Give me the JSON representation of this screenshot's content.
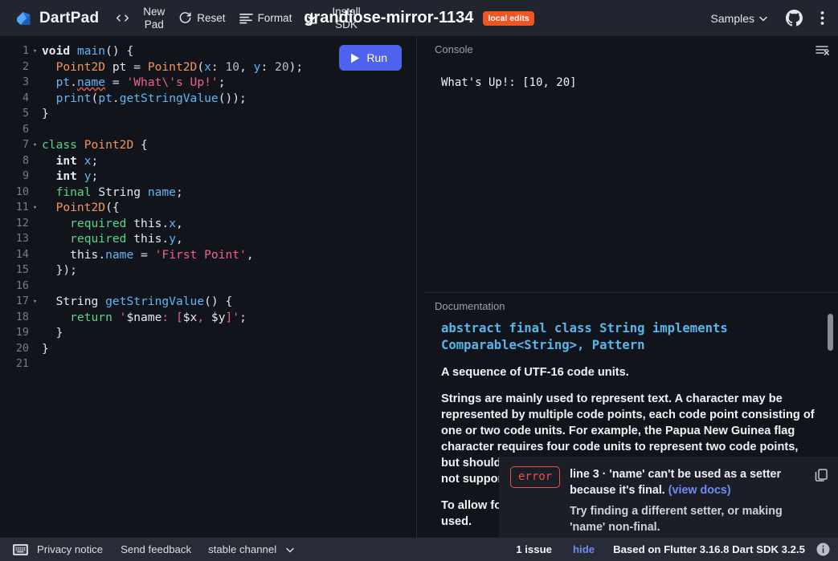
{
  "header": {
    "brand": "DartPad",
    "logo_icon": "dart-logo-icon",
    "actions": [
      {
        "icon": "code-brackets-icon",
        "label": "",
        "label2": ""
      },
      {
        "icon": "",
        "label": "New",
        "label2": "Pad"
      },
      {
        "icon": "refresh-icon",
        "label": "Reset",
        "label2": ""
      },
      {
        "icon": "format-lines-icon",
        "label": "Format",
        "label2": ""
      },
      {
        "icon": "download-icon",
        "label": "",
        "label2": ""
      },
      {
        "icon": "",
        "label": "Install",
        "label2": "SDK"
      }
    ],
    "code_icon_label": "<>",
    "new_pad_line1": "New",
    "new_pad_line2": "Pad",
    "reset_label": "Reset",
    "format_label": "Format",
    "install_line1": "Install",
    "install_line2": "SDK",
    "doc_title": "grandiose-mirror-1134",
    "local_edits_badge": "local edits",
    "samples_label": "Samples",
    "github_icon": "github-icon",
    "overflow_icon": "more-vertical-icon",
    "accent_badge_color": "#ee5622"
  },
  "editor": {
    "run_label": "Run",
    "run_icon": "play-icon",
    "run_color": "#4e62ee",
    "lines": [
      {
        "n": "1",
        "fold": "▾",
        "tokens": [
          {
            "t": "void",
            "c": "kw"
          },
          {
            "t": " ",
            "c": "pln"
          },
          {
            "t": "main",
            "c": "fn"
          },
          {
            "t": "() {",
            "c": "pln"
          }
        ]
      },
      {
        "n": "2",
        "fold": "",
        "tokens": [
          {
            "t": "  ",
            "c": "pln"
          },
          {
            "t": "Point2D",
            "c": "cls"
          },
          {
            "t": " pt = ",
            "c": "pln"
          },
          {
            "t": "Point2D",
            "c": "cls"
          },
          {
            "t": "(",
            "c": "pln"
          },
          {
            "t": "x",
            "c": "id"
          },
          {
            "t": ": ",
            "c": "pln"
          },
          {
            "t": "10",
            "c": "num"
          },
          {
            "t": ", ",
            "c": "pln"
          },
          {
            "t": "y",
            "c": "id"
          },
          {
            "t": ": ",
            "c": "pln"
          },
          {
            "t": "20",
            "c": "num"
          },
          {
            "t": ");",
            "c": "pln"
          }
        ]
      },
      {
        "n": "3",
        "fold": "",
        "tokens": [
          {
            "t": "  ",
            "c": "pln"
          },
          {
            "t": "pt",
            "c": "id"
          },
          {
            "t": ".",
            "c": "pln"
          },
          {
            "t": "name",
            "c": "id err-underline"
          },
          {
            "t": " = ",
            "c": "pln"
          },
          {
            "t": "'What\\'s Up!'",
            "c": "str"
          },
          {
            "t": ";",
            "c": "pln"
          }
        ]
      },
      {
        "n": "4",
        "fold": "",
        "tokens": [
          {
            "t": "  ",
            "c": "pln"
          },
          {
            "t": "print",
            "c": "fn"
          },
          {
            "t": "(",
            "c": "pln"
          },
          {
            "t": "pt",
            "c": "id"
          },
          {
            "t": ".",
            "c": "pln"
          },
          {
            "t": "getStringValue",
            "c": "fn"
          },
          {
            "t": "());",
            "c": "pln"
          }
        ]
      },
      {
        "n": "5",
        "fold": "",
        "tokens": [
          {
            "t": "}",
            "c": "pln"
          }
        ]
      },
      {
        "n": "6",
        "fold": "",
        "tokens": [
          {
            "t": "",
            "c": "pln"
          }
        ]
      },
      {
        "n": "7",
        "fold": "▾",
        "tokens": [
          {
            "t": "class",
            "c": "kw2"
          },
          {
            "t": " ",
            "c": "pln"
          },
          {
            "t": "Point2D",
            "c": "cls"
          },
          {
            "t": " {",
            "c": "pln"
          }
        ]
      },
      {
        "n": "8",
        "fold": "",
        "tokens": [
          {
            "t": "  ",
            "c": "pln"
          },
          {
            "t": "int",
            "c": "kw"
          },
          {
            "t": " ",
            "c": "pln"
          },
          {
            "t": "x",
            "c": "id"
          },
          {
            "t": ";",
            "c": "pln"
          }
        ]
      },
      {
        "n": "9",
        "fold": "",
        "tokens": [
          {
            "t": "  ",
            "c": "pln"
          },
          {
            "t": "int",
            "c": "kw"
          },
          {
            "t": " ",
            "c": "pln"
          },
          {
            "t": "y",
            "c": "id"
          },
          {
            "t": ";",
            "c": "pln"
          }
        ]
      },
      {
        "n": "10",
        "fold": "",
        "tokens": [
          {
            "t": "  ",
            "c": "pln"
          },
          {
            "t": "final",
            "c": "kw2"
          },
          {
            "t": " ",
            "c": "pln"
          },
          {
            "t": "String",
            "c": "typ"
          },
          {
            "t": " ",
            "c": "pln"
          },
          {
            "t": "name",
            "c": "id"
          },
          {
            "t": ";",
            "c": "pln"
          }
        ]
      },
      {
        "n": "11",
        "fold": "▾",
        "tokens": [
          {
            "t": "  ",
            "c": "pln"
          },
          {
            "t": "Point2D",
            "c": "cls"
          },
          {
            "t": "({",
            "c": "pln"
          }
        ]
      },
      {
        "n": "12",
        "fold": "",
        "tokens": [
          {
            "t": "    ",
            "c": "pln"
          },
          {
            "t": "required",
            "c": "kw2"
          },
          {
            "t": " ",
            "c": "pln"
          },
          {
            "t": "this",
            "c": "typ"
          },
          {
            "t": ".",
            "c": "pln"
          },
          {
            "t": "x",
            "c": "id"
          },
          {
            "t": ",",
            "c": "pln"
          }
        ]
      },
      {
        "n": "13",
        "fold": "",
        "tokens": [
          {
            "t": "    ",
            "c": "pln"
          },
          {
            "t": "required",
            "c": "kw2"
          },
          {
            "t": " ",
            "c": "pln"
          },
          {
            "t": "this",
            "c": "typ"
          },
          {
            "t": ".",
            "c": "pln"
          },
          {
            "t": "y",
            "c": "id"
          },
          {
            "t": ",",
            "c": "pln"
          }
        ]
      },
      {
        "n": "14",
        "fold": "",
        "tokens": [
          {
            "t": "    ",
            "c": "pln"
          },
          {
            "t": "this",
            "c": "typ"
          },
          {
            "t": ".",
            "c": "pln"
          },
          {
            "t": "name",
            "c": "id"
          },
          {
            "t": " = ",
            "c": "pln"
          },
          {
            "t": "'First Point'",
            "c": "str"
          },
          {
            "t": ",",
            "c": "pln"
          }
        ]
      },
      {
        "n": "15",
        "fold": "",
        "tokens": [
          {
            "t": "  });",
            "c": "pln"
          }
        ]
      },
      {
        "n": "16",
        "fold": "",
        "tokens": [
          {
            "t": "",
            "c": "pln"
          }
        ]
      },
      {
        "n": "17",
        "fold": "▾",
        "tokens": [
          {
            "t": "  ",
            "c": "pln"
          },
          {
            "t": "String",
            "c": "typ"
          },
          {
            "t": " ",
            "c": "pln"
          },
          {
            "t": "getStringValue",
            "c": "fn"
          },
          {
            "t": "() {",
            "c": "pln"
          }
        ]
      },
      {
        "n": "18",
        "fold": "",
        "tokens": [
          {
            "t": "    ",
            "c": "pln"
          },
          {
            "t": "return",
            "c": "kw2"
          },
          {
            "t": " ",
            "c": "pln"
          },
          {
            "t": "'",
            "c": "str"
          },
          {
            "t": "$name",
            "c": "typ"
          },
          {
            "t": ": [",
            "c": "str"
          },
          {
            "t": "$x",
            "c": "typ"
          },
          {
            "t": ", ",
            "c": "str"
          },
          {
            "t": "$y",
            "c": "typ"
          },
          {
            "t": "]'",
            "c": "str"
          },
          {
            "t": ";",
            "c": "pln"
          }
        ]
      },
      {
        "n": "19",
        "fold": "",
        "tokens": [
          {
            "t": "  }",
            "c": "pln"
          }
        ]
      },
      {
        "n": "20",
        "fold": "",
        "tokens": [
          {
            "t": "}",
            "c": "pln"
          }
        ]
      },
      {
        "n": "21",
        "fold": "",
        "tokens": [
          {
            "t": "",
            "c": "pln"
          }
        ]
      }
    ]
  },
  "console": {
    "title": "Console",
    "clear_icon": "clear-console-icon",
    "output": "What's Up!: [10, 20]"
  },
  "documentation": {
    "title": "Documentation",
    "signature": "abstract final class String implements Comparable<String>, Pattern",
    "paragraphs": [
      "A sequence of UTF-16 code units.",
      "Strings are mainly used to represent text. A character may be represented by multiple code points, each code point consisting of one or two code units. For example, the Papua New Guinea flag character requires four code units to represent two code points, but should be treated as a single character: \"🇵🇬\". Platforms that do not support the flag character may show the letters \"PG\" instead.",
      "To allow for a readable source code, the escape \"\\u{1F1F5}\" can be used."
    ],
    "scrollbar": "doc-scrollbar"
  },
  "error_panel": {
    "severity": "error",
    "severity_color": "#e5534b",
    "message": "line 3 · 'name' can't be used as a setter because it's final.",
    "link_label": "(view docs)",
    "correction": "Try finding a different setter, or making 'name' non-final.",
    "copy_icon": "copy-icon"
  },
  "footer": {
    "keyboard_icon": "keyboard-icon",
    "privacy_label": "Privacy notice",
    "feedback_label": "Send feedback",
    "channel_label": "stable channel",
    "channel_caret": "chevron-down-icon",
    "issue_count": "1 issue",
    "hide_label": "hide",
    "version": "Based on Flutter 3.16.8 Dart SDK 3.2.5",
    "info_icon": "info-icon"
  }
}
